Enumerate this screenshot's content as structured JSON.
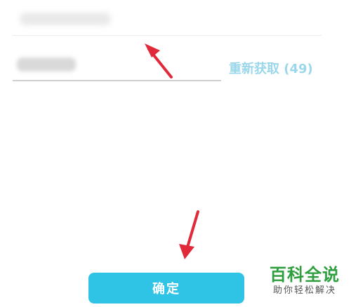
{
  "form": {
    "phone_value": "",
    "code_value": "",
    "resend_label": "重新获取 (49)",
    "confirm_label": "确定"
  },
  "watermark": {
    "title": "百科全说",
    "subtitle": "助你轻松解决"
  },
  "colors": {
    "primary": "#2fc4e6",
    "resend_text": "#9bd7ea",
    "annotation_arrow": "#e02a3a",
    "watermark_green": "#2f9e3f"
  }
}
